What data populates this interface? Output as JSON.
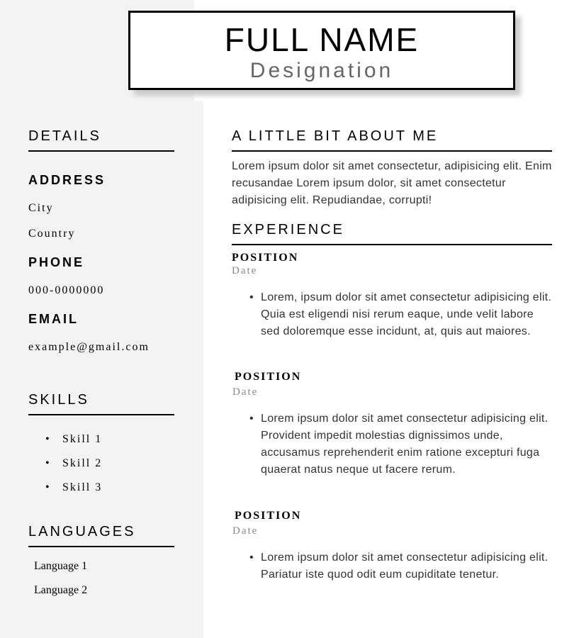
{
  "header": {
    "name": "FULL NAME",
    "designation": "Designation"
  },
  "sidebar": {
    "details_title": "DETAILS",
    "address_label": "ADDRESS",
    "city": "City",
    "country": "Country",
    "phone_label": "PHONE",
    "phone": "000-0000000",
    "email_label": "EMAIL",
    "email": "example@gmail.com",
    "skills_title": "SKILLS",
    "skills": [
      "Skill 1",
      "Skill 2",
      "Skill 3"
    ],
    "languages_title": "LANGUAGES",
    "languages": [
      "Language 1",
      "Language 2"
    ]
  },
  "main": {
    "about_title": "A LITTLE BIT ABOUT ME",
    "about_text": "Lorem ipsum dolor sit amet consectetur, adipisicing elit. Enim recusandae Lorem ipsum dolor, sit amet consectetur adipisicing elit. Repudiandae, corrupti!",
    "experience_title": "EXPERIENCE",
    "experience": [
      {
        "position": "POSITION",
        "date": "Date",
        "description": "Lorem, ipsum dolor sit amet consectetur adipisicing elit. Quia est eligendi nisi rerum eaque, unde velit labore sed doloremque esse incidunt, at, quis aut maiores."
      },
      {
        "position": "POSITION",
        "date": "Date",
        "description": "Lorem ipsum dolor sit amet consectetur adipisicing elit. Provident impedit molestias dignissimos unde, accusamus reprehenderit enim ratione excepturi fuga quaerat natus neque ut facere rerum."
      },
      {
        "position": "POSITION",
        "date": "Date",
        "description": "Lorem ipsum dolor sit amet consectetur adipisicing elit. Pariatur iste quod odit eum cupiditate tenetur."
      }
    ]
  }
}
